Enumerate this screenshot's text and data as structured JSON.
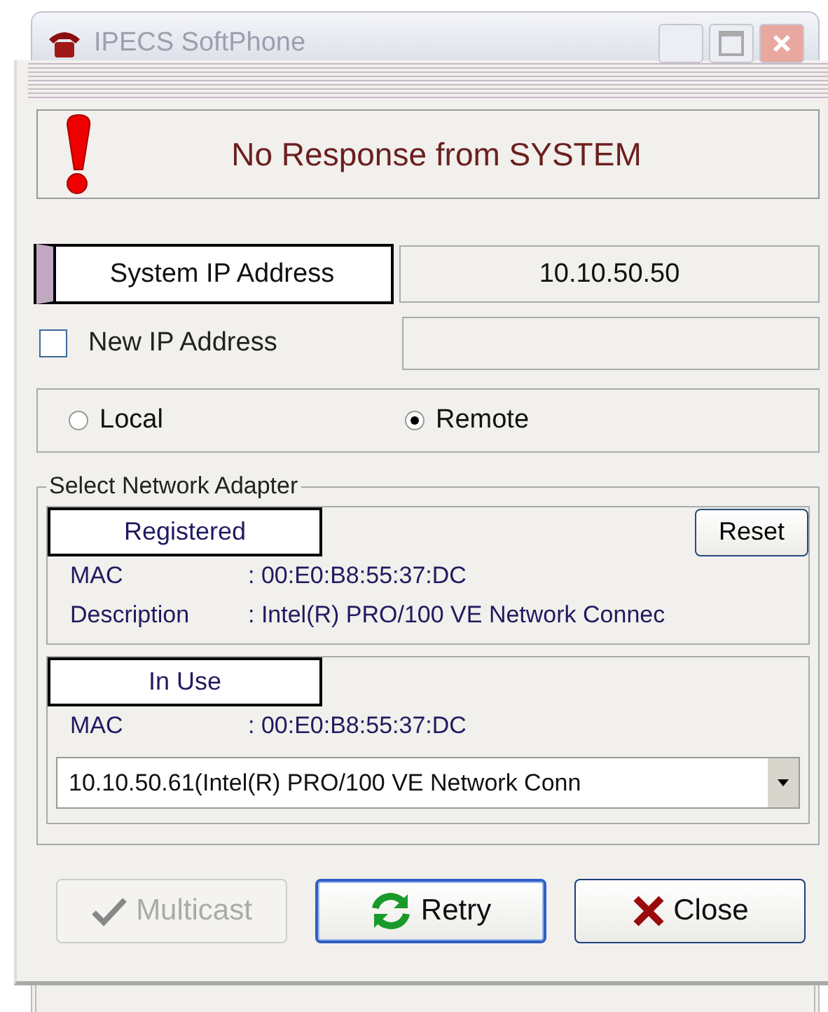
{
  "background_window": {
    "title": "IPECS SoftPhone"
  },
  "message": "No Response from SYSTEM",
  "system_ip": {
    "label": "System IP Address",
    "value": "10.10.50.50"
  },
  "new_ip": {
    "label": "New IP Address",
    "checked": false
  },
  "mode": [
    {
      "label": "Local",
      "selected": false
    },
    {
      "label": "Remote",
      "selected": true
    }
  ],
  "adapter": {
    "legend": "Select Network Adapter",
    "registered": {
      "title": "Registered",
      "reset": "Reset",
      "fields": [
        {
          "label": "MAC",
          "value": ": 00:E0:B8:55:37:DC"
        },
        {
          "label": "Description",
          "value": ": Intel(R) PRO/100 VE Network Connec"
        }
      ]
    },
    "in_use": {
      "title": "In Use",
      "fields": [
        {
          "label": "MAC",
          "value": ": 00:E0:B8:55:37:DC"
        }
      ],
      "selection": "10.10.50.61(Intel(R) PRO/100 VE Network Conn"
    }
  },
  "buttons": [
    {
      "label": "Multicast",
      "kind": "check",
      "disabled": true,
      "default": false
    },
    {
      "label": "Retry",
      "kind": "retry",
      "disabled": false,
      "default": true
    },
    {
      "label": "Close",
      "kind": "close",
      "disabled": false,
      "default": false
    }
  ]
}
